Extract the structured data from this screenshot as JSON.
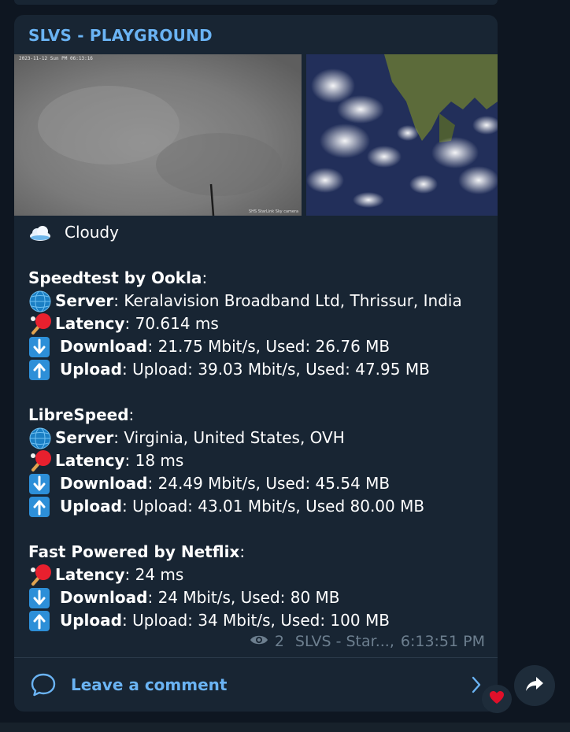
{
  "channel": {
    "name": "SLVS - PLAYGROUND"
  },
  "media": {
    "sky_cam_overlay": "2023-11-12 Sun PM 06:13:16",
    "sky_cam_watermark": "SHS StarLink Sky camera"
  },
  "message": {
    "weather": {
      "icon": "cloud-icon",
      "text": "Cloudy"
    },
    "sections": [
      {
        "title": "Speedtest by Ookla",
        "title_suffix": ":",
        "rows": [
          {
            "icon": "globe-icon",
            "label": "Server",
            "value": ": Keralavision Broadband Ltd, Thrissur, India"
          },
          {
            "icon": "ping-pong-icon",
            "label": "Latency",
            "value": ": 70.614 ms"
          },
          {
            "icon": "download-arrow-icon",
            "label": "Download",
            "value": ": 21.75 Mbit/s, Used: 26.76 MB"
          },
          {
            "icon": "upload-arrow-icon",
            "label": "Upload",
            "value": ": Upload: 39.03 Mbit/s, Used: 47.95 MB"
          }
        ]
      },
      {
        "title": "LibreSpeed",
        "title_suffix": ":",
        "rows": [
          {
            "icon": "globe-icon",
            "label": "Server",
            "value": ": Virginia, United States, OVH"
          },
          {
            "icon": "ping-pong-icon",
            "label": "Latency",
            "value": ": 18 ms"
          },
          {
            "icon": "download-arrow-icon",
            "label": "Download",
            "value": ": 24.49 Mbit/s, Used: 45.54 MB"
          },
          {
            "icon": "upload-arrow-icon",
            "label": "Upload",
            "value": ": Upload: 43.01 Mbit/s, Used 80.00 MB"
          }
        ]
      },
      {
        "title": "Fast Powered by Netflix",
        "title_suffix": ":",
        "rows": [
          {
            "icon": "ping-pong-icon",
            "label": "Latency",
            "value": ": 24 ms"
          },
          {
            "icon": "download-arrow-icon",
            "label": "Download",
            "value": ": 24 Mbit/s, Used: 80 MB"
          },
          {
            "icon": "upload-arrow-icon",
            "label": "Upload",
            "value": ": Upload: 34 Mbit/s, Used: 100 MB"
          }
        ]
      }
    ]
  },
  "meta": {
    "views": "2",
    "author": "SLVS - Star...,",
    "time": "6:13:51 PM"
  },
  "comments": {
    "label": "Leave a comment"
  },
  "reactions": {
    "icon": "heart-icon"
  },
  "colors": {
    "accent": "#6ab3f3",
    "bubble": "#182533",
    "background": "#0e1621",
    "meta": "#6d7f8f"
  }
}
